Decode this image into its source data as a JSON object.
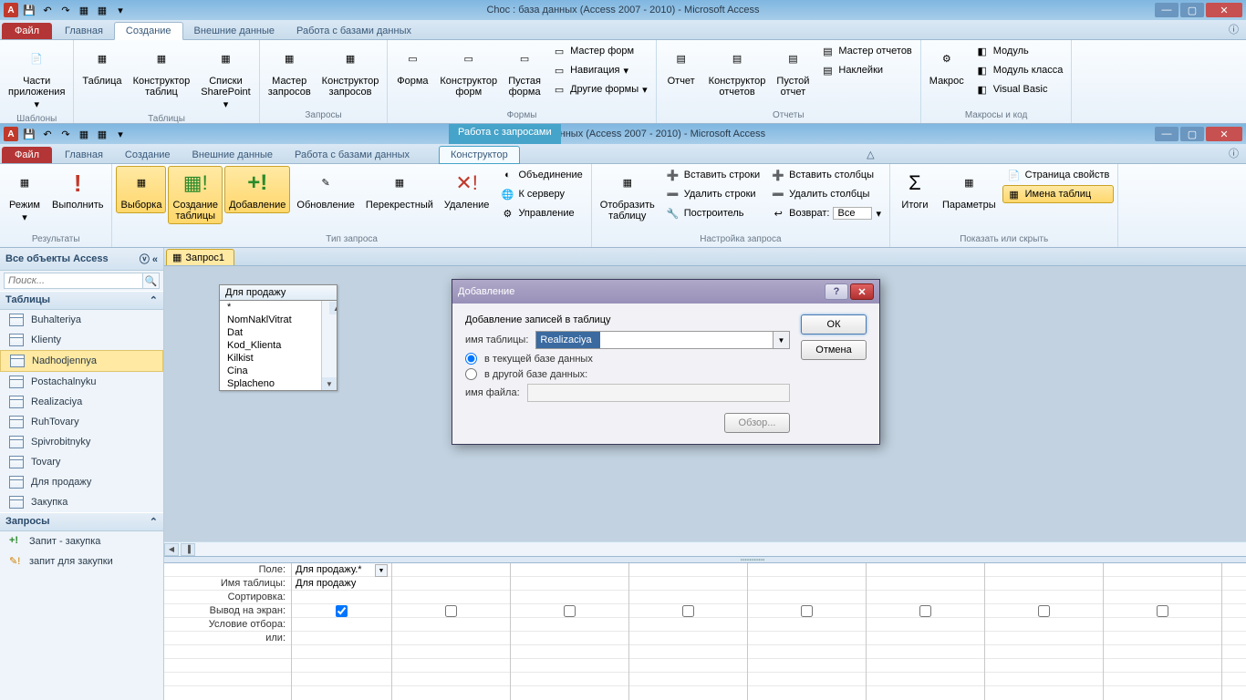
{
  "win1": {
    "title": "Choc : база данных (Access 2007 - 2010)  -  Microsoft Access",
    "tabs": {
      "file": "Файл",
      "home": "Главная",
      "create": "Создание",
      "extdata": "Внешние данные",
      "dbtools": "Работа с базами данных"
    },
    "groups": {
      "templates": {
        "label": "Шаблоны",
        "appparts": "Части\nприложения"
      },
      "tables": {
        "label": "Таблицы",
        "table": "Таблица",
        "tdesign": "Конструктор\nтаблиц",
        "splists": "Списки\nSharePoint"
      },
      "queries": {
        "label": "Запросы",
        "qwiz": "Мастер\nзапросов",
        "qdesign": "Конструктор\nзапросов"
      },
      "forms": {
        "label": "Формы",
        "form": "Форма",
        "fdesign": "Конструктор\nформ",
        "blank": "Пустая\nформа",
        "fwiz": "Мастер форм",
        "nav": "Навигация",
        "other": "Другие формы"
      },
      "reports": {
        "label": "Отчеты",
        "report": "Отчет",
        "rdesign": "Конструктор\nотчетов",
        "blank": "Пустой\nотчет",
        "rwiz": "Мастер отчетов",
        "labels": "Наклейки"
      },
      "macros": {
        "label": "Макросы и код",
        "macro": "Макрос",
        "module": "Модуль",
        "clsmod": "Модуль класса",
        "vb": "Visual Basic"
      }
    }
  },
  "win2": {
    "title": "Choc : база данных (Access 2007 - 2010)  -  Microsoft Access",
    "ctxtitle": "Работа с запросами",
    "tabs": {
      "file": "Файл",
      "home": "Главная",
      "create": "Создание",
      "extdata": "Внешние данные",
      "dbtools": "Работа с базами данных",
      "design": "Конструктор"
    },
    "groups": {
      "results": {
        "label": "Результаты",
        "view": "Режим",
        "run": "Выполнить"
      },
      "qtype": {
        "label": "Тип запроса",
        "select": "Выборка",
        "mktbl": "Создание\nтаблицы",
        "append": "Добавление",
        "update": "Обновление",
        "cross": "Перекрестный",
        "delete": "Удаление",
        "union": "Объединение",
        "passthru": "К серверу",
        "datadef": "Управление"
      },
      "qsetup": {
        "label": "Настройка запроса",
        "showtbl": "Отобразить\nтаблицу",
        "insrows": "Вставить строки",
        "delrows": "Удалить строки",
        "builder": "Построитель",
        "inscols": "Вставить столбцы",
        "delcols": "Удалить столбцы",
        "return": "Возврат:",
        "returnval": "Все"
      },
      "showhide": {
        "label": "Показать или скрыть",
        "totals": "Итоги",
        "params": "Параметры",
        "propsheet": "Страница свойств",
        "tblnames": "Имена таблиц"
      }
    }
  },
  "nav": {
    "header": "Все объекты Access",
    "search": "Поиск...",
    "tablesHdr": "Таблицы",
    "tables": [
      "Buhalteriya",
      "Klienty",
      "Nadhodjennya",
      "Postachalnyku",
      "Realizaciya",
      "RuhTovary",
      "Spivrobitnyky",
      "Tovary",
      "Для продажу",
      "Закупка"
    ],
    "selectedTable": "Nadhodjennya",
    "queriesHdr": "Запросы",
    "queries": [
      "Запит - закупка",
      "запит для закупки"
    ]
  },
  "doc": {
    "tab": "Запрос1"
  },
  "tablebox": {
    "title": "Для продажу",
    "fields": [
      "*",
      "NomNaklVitrat",
      "Dat",
      "Kod_Klienta",
      "Kilkist",
      "Cina",
      "Splacheno"
    ]
  },
  "grid": {
    "labels": {
      "field": "Поле:",
      "table": "Имя таблицы:",
      "sort": "Сортировка:",
      "show": "Вывод на экран:",
      "crit": "Условие отбора:",
      "or": "или:"
    },
    "col1": {
      "field": "Для продажу.*",
      "table": "Для продажу"
    }
  },
  "dialog": {
    "title": "Добавление",
    "legend": "Добавление записей в таблицу",
    "tblLabel": "имя таблицы:",
    "tblValue": "Realizaciya",
    "optCurrent": "в текущей базе данных",
    "optOther": "в другой базе данных:",
    "fileLabel": "имя файла:",
    "browse": "Обзор...",
    "ok": "ОК",
    "cancel": "Отмена"
  }
}
